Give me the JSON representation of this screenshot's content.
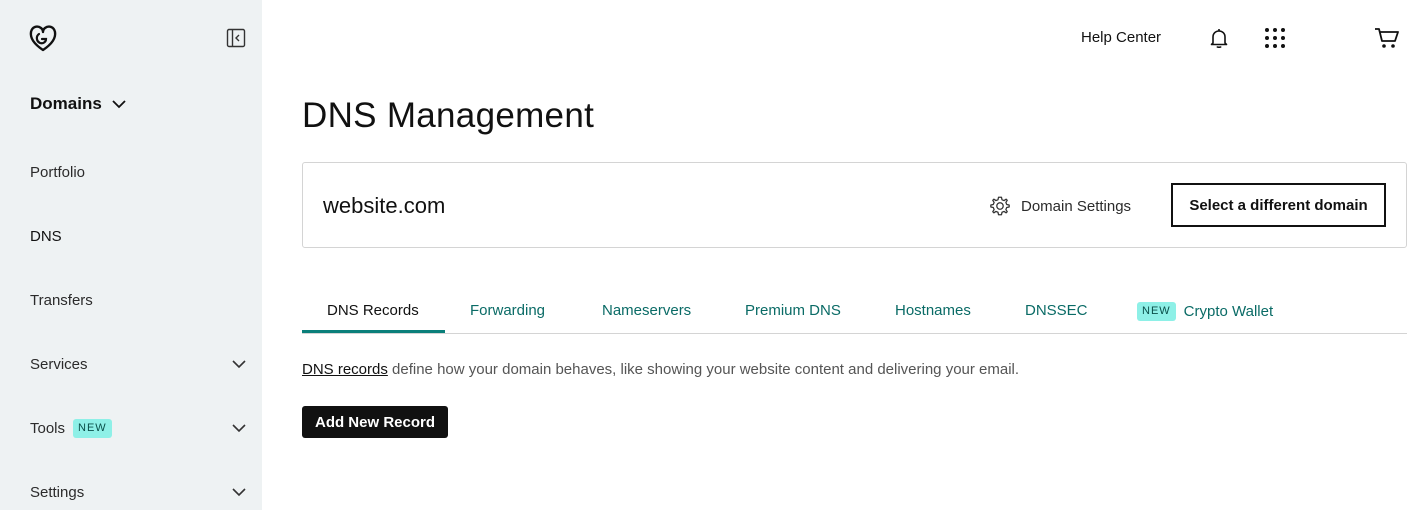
{
  "sidebar": {
    "section_label": "Domains",
    "items": [
      {
        "label": "Portfolio",
        "expandable": false
      },
      {
        "label": "DNS",
        "expandable": false
      },
      {
        "label": "Transfers",
        "expandable": false
      },
      {
        "label": "Services",
        "expandable": true
      },
      {
        "label": "Tools",
        "expandable": true,
        "badge": "NEW"
      },
      {
        "label": "Settings",
        "expandable": true
      }
    ]
  },
  "header": {
    "help_center": "Help Center"
  },
  "main": {
    "title": "DNS Management",
    "domain": "website.com",
    "domain_settings_label": "Domain Settings",
    "select_domain_label": "Select a different domain",
    "tabs": [
      {
        "label": "DNS Records",
        "active": true
      },
      {
        "label": "Forwarding"
      },
      {
        "label": "Nameservers"
      },
      {
        "label": "Premium DNS"
      },
      {
        "label": "Hostnames"
      },
      {
        "label": "DNSSEC"
      },
      {
        "label": "Crypto Wallet",
        "badge": "NEW"
      }
    ],
    "description_link": "DNS records",
    "description_rest": " define how your domain behaves, like showing your website content and delivering your email.",
    "add_record_label": "Add New Record"
  },
  "colors": {
    "sidebar_bg": "#eef2f3",
    "accent_teal": "#0a6b66",
    "badge_bg": "#8ef0e7",
    "primary_button": "#111111"
  }
}
